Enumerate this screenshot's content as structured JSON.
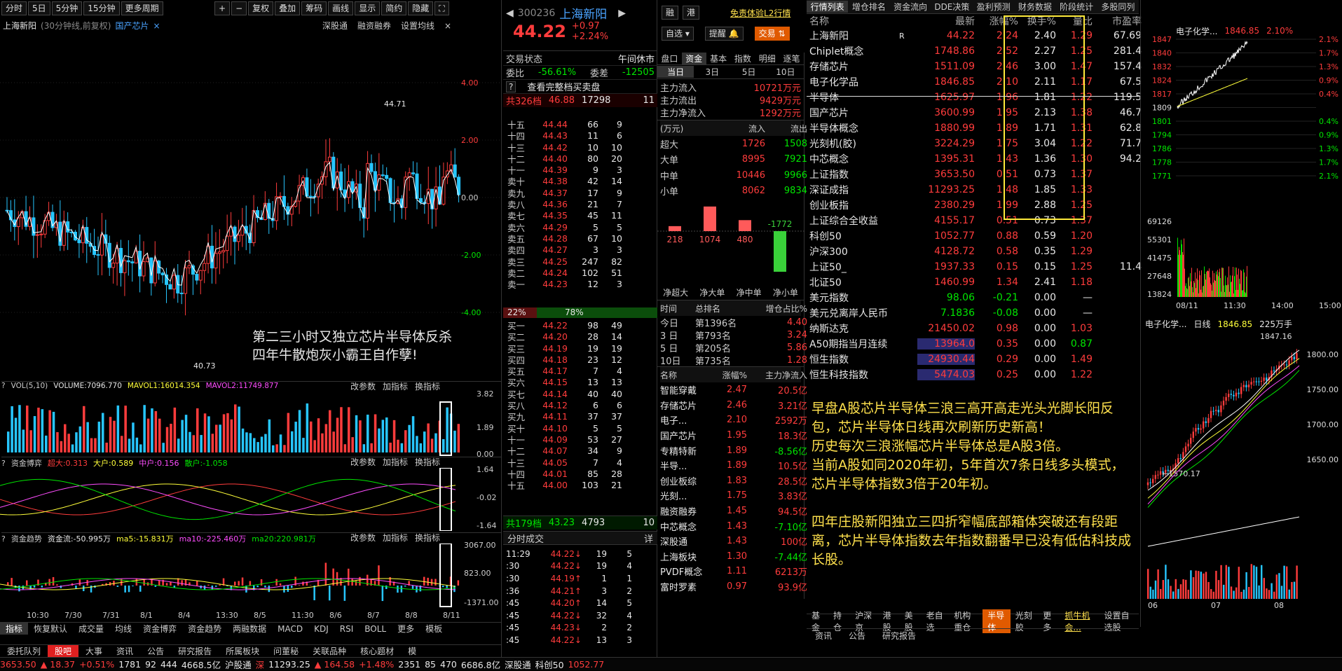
{
  "toolbar": {
    "items": [
      "分时",
      "5日",
      "5分钟",
      "15分钟",
      "更多周期"
    ],
    "tools": [
      "+",
      "−",
      "复权",
      "叠加",
      "筹码",
      "画线",
      "显示",
      "简约",
      "隐藏"
    ]
  },
  "chart": {
    "title": "上海新阳",
    "subtitle": "(30分钟线,前复权)",
    "concept": "国产芯片",
    "right_btns": [
      "深股通",
      "融资融券",
      "设置均线"
    ],
    "yticks": [
      "4.00",
      "2.00",
      "0.00",
      "-2.00",
      "-4.00"
    ],
    "hi_label": "44.71",
    "lo_label": "40.73",
    "annotation": [
      "第二三小时又独立芯片半导体反杀",
      "四年牛散炮灰小霸王自作孽!"
    ],
    "vol_label": "VOL(5,10)",
    "vol_value": "VOLUME:7096.770",
    "vol_ma1": "MAVOL1:16014.354",
    "vol_ma2": "MAVOL2:11749.877",
    "vol_yticks": [
      "3.82",
      "1.89",
      "0.00"
    ],
    "game_label": "资金博弈",
    "game_vals": [
      "超大:0.313",
      "大户:0.589",
      "中户:0.156",
      "散户:-1.058"
    ],
    "game_yticks": [
      "1.64",
      "-0.02",
      "-1.64"
    ],
    "trend_label": "资金趋势",
    "trend_vals": [
      "资金流:-50.995万",
      "ma5:-15.831万",
      "ma10:-225.460万",
      "ma20:220.981万"
    ],
    "trend_yticks": [
      "3067.00",
      "823.00",
      "-1371.00"
    ],
    "sub_btns": [
      "改参数",
      "加指标",
      "换指标"
    ],
    "xticks": [
      "10:30",
      "7/30",
      "7/31",
      "8/1",
      "8/4",
      "13:30",
      "8/5",
      "11:30",
      "8/6",
      "8/7",
      "8/8",
      "8/11"
    ],
    "tabs": [
      "指标",
      "恢复默认",
      "成交量",
      "均线",
      "资金博弈",
      "资金趋势",
      "两融数据",
      "MACD",
      "KDJ",
      "RSI",
      "BOLL",
      "更多",
      "模板"
    ]
  },
  "stock": {
    "code": "300236",
    "name": "上海新阳",
    "price": "44.22",
    "chg": "+0.97",
    "pct": "+2.24%",
    "tag1": "融",
    "tag2": "港",
    "l2": "免责体验L2行情",
    "btn_self": "自选",
    "btn_alert": "提醒",
    "btn_trade": "交易",
    "status_label": "交易状态",
    "status_val": "午间休市",
    "wb_label": "委比",
    "wb_val": "-56.61%",
    "wc_label": "委差",
    "wc_val": "-12505",
    "full": "查看完整档买卖盘",
    "sell_total": [
      "共326档",
      "46.88",
      "17298",
      "11"
    ],
    "buy_total": [
      "共179档",
      "43.23",
      "4793",
      "10"
    ],
    "ratio": [
      "22%",
      "78%"
    ]
  },
  "sells": [
    [
      "十五",
      "44.44",
      "66",
      "9"
    ],
    [
      "十四",
      "44.43",
      "11",
      "6"
    ],
    [
      "十三",
      "44.42",
      "10",
      "10"
    ],
    [
      "十二",
      "44.40",
      "80",
      "20"
    ],
    [
      "十一",
      "44.39",
      "9",
      "3"
    ],
    [
      "卖十",
      "44.38",
      "42",
      "14"
    ],
    [
      "卖九",
      "44.37",
      "17",
      "9"
    ],
    [
      "卖八",
      "44.36",
      "21",
      "7"
    ],
    [
      "卖七",
      "44.35",
      "45",
      "11"
    ],
    [
      "卖六",
      "44.29",
      "5",
      "5"
    ],
    [
      "卖五",
      "44.28",
      "67",
      "10"
    ],
    [
      "卖四",
      "44.27",
      "3",
      "3"
    ],
    [
      "卖三",
      "44.25",
      "247",
      "82"
    ],
    [
      "卖二",
      "44.24",
      "102",
      "51"
    ],
    [
      "卖一",
      "44.23",
      "12",
      "3"
    ]
  ],
  "buys": [
    [
      "买一",
      "44.22",
      "98",
      "49"
    ],
    [
      "买二",
      "44.20",
      "28",
      "14"
    ],
    [
      "买三",
      "44.19",
      "19",
      "19"
    ],
    [
      "买四",
      "44.18",
      "23",
      "12"
    ],
    [
      "买五",
      "44.17",
      "7",
      "4"
    ],
    [
      "买六",
      "44.15",
      "13",
      "13"
    ],
    [
      "买七",
      "44.14",
      "40",
      "40"
    ],
    [
      "买八",
      "44.12",
      "6",
      "6"
    ],
    [
      "买九",
      "44.11",
      "37",
      "37"
    ],
    [
      "买十",
      "44.10",
      "5",
      "5"
    ],
    [
      "十一",
      "44.09",
      "53",
      "27"
    ],
    [
      "十二",
      "44.07",
      "34",
      "9"
    ],
    [
      "十三",
      "44.05",
      "7",
      "4"
    ],
    [
      "十四",
      "44.01",
      "85",
      "28"
    ],
    [
      "十五",
      "44.00",
      "103",
      "21"
    ]
  ],
  "trades_label": "分时成交",
  "trades_more": "详",
  "trades": [
    [
      "11:29",
      "44.22",
      "19",
      "5"
    ],
    [
      ":30",
      "44.22",
      "19",
      "4"
    ],
    [
      ":30",
      "44.19",
      "1",
      "1"
    ],
    [
      ":36",
      "44.21",
      "3",
      "2"
    ],
    [
      ":45",
      "44.20",
      "14",
      "5"
    ],
    [
      ":45",
      "44.22",
      "32",
      "4"
    ],
    [
      ":45",
      "44.23",
      "2",
      "2"
    ],
    [
      ":45",
      "44.22",
      "13",
      "3"
    ]
  ],
  "flow": {
    "tabs": [
      "盘口",
      "资金",
      "基本",
      "指数",
      "明细",
      "逐笔"
    ],
    "periods": [
      "当日",
      "3日",
      "5日",
      "10日"
    ],
    "main": [
      [
        "主力流入",
        "10721万元"
      ],
      [
        "主力流出",
        "9429万元"
      ],
      [
        "主力净流入",
        "1292万元"
      ]
    ],
    "hdr": [
      "(万元)",
      "流入",
      "流出"
    ],
    "rows": [
      [
        "超大",
        "1726",
        "1508"
      ],
      [
        "大单",
        "8995",
        "7921"
      ],
      [
        "中单",
        "10446",
        "9966"
      ],
      [
        "小单",
        "8062",
        "9834"
      ]
    ],
    "bars": [
      {
        "label": "218",
        "value": 218
      },
      {
        "label": "1074",
        "value": 1074
      },
      {
        "label": "480",
        "value": 480
      },
      {
        "label": "-1772",
        "value": -1772
      }
    ],
    "bar_cats": [
      "净超大",
      "净大单",
      "净中单",
      "净小单"
    ],
    "rank_hdr": [
      "时间",
      "总排名",
      "增仓占比%"
    ],
    "rank": [
      [
        "今日",
        "第1396名",
        "4.40"
      ],
      [
        "3 日",
        "第793名",
        "3.24"
      ],
      [
        "5 日",
        "第205名",
        "5.86"
      ],
      [
        "10日",
        "第735名",
        "1.28"
      ]
    ],
    "sec_hdr": [
      "名称",
      "涨幅%",
      "主力净流入"
    ],
    "sectors": [
      [
        "智能穿戴",
        "2.47",
        "20.5亿"
      ],
      [
        "存储芯片",
        "2.46",
        "3.21亿"
      ],
      [
        "电子...",
        "2.10",
        "2592万"
      ],
      [
        "国产芯片",
        "1.95",
        "18.3亿"
      ],
      [
        "专精特新",
        "1.89",
        "-8.56亿"
      ],
      [
        "半导...",
        "1.89",
        "10.5亿"
      ],
      [
        "创业板综",
        "1.83",
        "28.5亿"
      ],
      [
        "光刻...",
        "1.75",
        "3.83亿"
      ],
      [
        "融资融券",
        "1.45",
        "94.5亿"
      ],
      [
        "中芯概念",
        "1.43",
        "-7.10亿"
      ],
      [
        "深股通",
        "1.43",
        "100亿"
      ],
      [
        "上海板块",
        "1.30",
        "-7.44亿"
      ],
      [
        "PVDF概念",
        "1.11",
        "6213万"
      ],
      [
        "富时罗素",
        "0.97",
        "93.9亿"
      ]
    ]
  },
  "table": {
    "tabs": [
      "行情列表",
      "增仓排名",
      "资金流向",
      "DDE决策",
      "盈利预测",
      "财务数据",
      "阶段统计",
      "多股同列"
    ],
    "hdr": [
      "名称",
      "",
      "最新",
      "涨幅%",
      "换手%",
      "量比",
      "市盈率"
    ],
    "rows": [
      [
        "上海新阳",
        "R",
        "44.22",
        "2.24",
        "2.40",
        "1.29",
        "67.69"
      ],
      [
        "Chiplet概念",
        "",
        "1748.86",
        "2.52",
        "2.27",
        "1.25",
        "281.4"
      ],
      [
        "存储芯片",
        "",
        "1511.09",
        "2.46",
        "3.00",
        "1.47",
        "157.4"
      ],
      [
        "电子化学品",
        "",
        "1846.85",
        "2.10",
        "2.11",
        "1.17",
        "67.5"
      ],
      [
        "半导体",
        "",
        "1625.97",
        "1.96",
        "1.81",
        "1.22",
        "119.5"
      ],
      [
        "国产芯片",
        "",
        "3600.99",
        "1.95",
        "2.13",
        "1.38",
        "46.7"
      ],
      [
        "半导体概念",
        "",
        "1880.99",
        "1.89",
        "1.71",
        "1.31",
        "62.8"
      ],
      [
        "光刻机(胶)",
        "",
        "3224.29",
        "1.75",
        "3.04",
        "1.22",
        "71.7"
      ],
      [
        "中芯概念",
        "",
        "1395.31",
        "1.43",
        "1.36",
        "1.30",
        "94.2"
      ],
      [
        "上证指数",
        "",
        "3653.50",
        "0.51",
        "0.73",
        "1.37",
        ""
      ],
      [
        "深证成指",
        "",
        "11293.25",
        "1.48",
        "1.85",
        "1.33",
        ""
      ],
      [
        "创业板指",
        "",
        "2380.29",
        "1.99",
        "2.88",
        "1.25",
        ""
      ],
      [
        "上证综合全收益",
        "",
        "4155.17",
        "0.51",
        "0.73",
        "1.37",
        ""
      ],
      [
        "科创50",
        "",
        "1052.77",
        "0.88",
        "0.59",
        "1.20",
        ""
      ],
      [
        "沪深300",
        "",
        "4128.72",
        "0.58",
        "0.35",
        "1.29",
        ""
      ],
      [
        "上证50_",
        "",
        "1937.33",
        "0.15",
        "0.15",
        "1.25",
        "11.4"
      ],
      [
        "北证50",
        "",
        "1460.99",
        "1.34",
        "2.41",
        "1.18",
        ""
      ],
      [
        "美元指数",
        "",
        "98.06",
        "-0.21",
        "0.00",
        "—",
        ""
      ],
      [
        "美元兑离岸人民币",
        "",
        "7.1836",
        "-0.08",
        "0.00",
        "—",
        ""
      ],
      [
        "纳斯达克",
        "",
        "21450.02",
        "0.98",
        "0.00",
        "1.03",
        ""
      ],
      [
        "A50期指当月连续",
        "",
        "13964.0",
        "0.35",
        "0.00",
        "0.87",
        ""
      ],
      [
        "恒生指数",
        "",
        "24930.44",
        "0.29",
        "0.00",
        "1.49",
        ""
      ],
      [
        "恒生科技指数",
        "",
        "5474.03",
        "0.25",
        "0.00",
        "1.22",
        ""
      ]
    ],
    "notes": [
      "早盘A股芯片半导体三浪三高开高走光头光脚长阳反包，芯片半导体日线再次刷新历史新高！",
      "历史每次三浪涨幅芯片半导体总是A股3倍。",
      "当前A股如同2020年初，5年首次7条日线多头模式，芯片半导体指数3倍于20年初。",
      "",
      "四年庄股新阳独立三四折窄幅底部箱体突破还有段距离，芯片半导体指数去年指数翻番早已没有低估科技成长股。"
    ],
    "bottom_tabs": [
      "基金",
      "持仓",
      "沪深京",
      "港股",
      "美股",
      "老自选",
      "机构重仓",
      "半导体",
      "光刻胶",
      "更多",
      "抓牛机会...",
      "设置自选股"
    ],
    "sub_tabs": [
      "资讯",
      "公告",
      "研究报告"
    ]
  },
  "mini": {
    "name": "电子化学...",
    "price": "1846.85",
    "pct": "2.10%",
    "yl": [
      "1847",
      "1840",
      "1832",
      "1824",
      "1817",
      "1809",
      "1801",
      "1794",
      "1786",
      "1778",
      "1771"
    ],
    "yr": [
      "2.1%",
      "1.7%",
      "1.3%",
      "0.9%",
      "0.4%",
      "",
      "0.4%",
      "0.9%",
      "1.3%",
      "1.7%",
      "2.1%"
    ],
    "vol_y": [
      "69126",
      "55301",
      "41475",
      "27648",
      "13824"
    ],
    "xt": [
      "08/11",
      "11:30",
      "14:00",
      "15:00"
    ],
    "k_name": "电子化学...",
    "k_period": "日线",
    "k_price": "1846.85",
    "k_hand": "225万手",
    "k_hi": "1847.16",
    "k_lo": "1570.17",
    "k_y": [
      "1800.00",
      "1750.00",
      "1700.00",
      "1650.00"
    ],
    "k_x": [
      "06",
      "07",
      "08"
    ]
  },
  "bottom": {
    "tabs": [
      "委托队列",
      "股吧",
      "大事",
      "资讯",
      "公告",
      "研究报告",
      "所属板块",
      "问董秘",
      "关联品种",
      "核心题材",
      "模"
    ],
    "ticker": [
      "3653.50",
      "▲ 18.37",
      "+0.51%",
      "1781",
      "92",
      "444",
      "4668.5亿",
      "沪股通",
      "深",
      "11293.25",
      "▲ 164.58",
      "+1.48%",
      "2351",
      "85",
      "470",
      "6686.8亿",
      "深股通",
      "科创50",
      "1052.77"
    ]
  }
}
